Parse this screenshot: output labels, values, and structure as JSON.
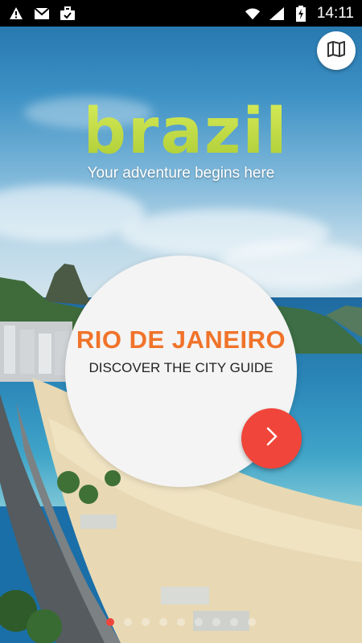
{
  "status_bar": {
    "time": "14:11",
    "left_icons": [
      "warning-icon",
      "mail-icon",
      "briefcase-icon"
    ],
    "right_icons": [
      "wifi-icon",
      "signal-icon",
      "battery-charging-icon"
    ]
  },
  "header": {
    "logo_text": "brazil",
    "tagline": "Your adventure begins here",
    "map_button_icon": "map-icon"
  },
  "card": {
    "title": "RIO DE JANEIRO",
    "subtitle": "DISCOVER THE CITY GUIDE",
    "next_icon": "chevron-right-icon"
  },
  "pager": {
    "total_pages": 9,
    "active_page": 1
  },
  "colors": {
    "accent": "#f0453a",
    "title": "#f0732a",
    "logo": "#c8e04a"
  }
}
